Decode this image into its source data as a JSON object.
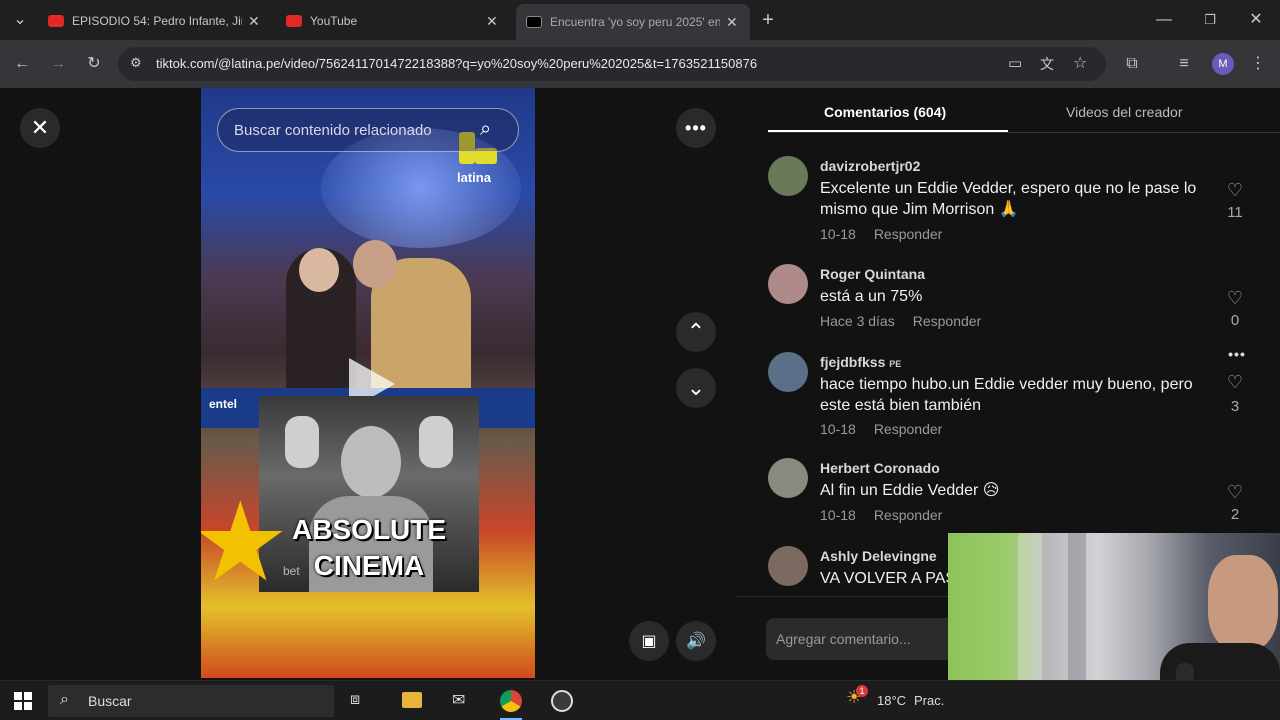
{
  "browser": {
    "tabs": [
      {
        "title": "EPISODIO 54: Pedro Infante, Jim",
        "favicon_color": "#e02a2a",
        "active": false
      },
      {
        "title": "YouTube",
        "favicon_color": "#e02a2a",
        "active": false
      },
      {
        "title": "Encuentra 'yo soy peru 2025' en",
        "favicon_color": "#000000",
        "active": true
      }
    ],
    "new_tab_icon": "plus-icon",
    "url": "tiktok.com/@latina.pe/video/7562411701472218388?q=yo%20soy%20peru%202025&t=1763521150876",
    "profile_initial": "M"
  },
  "video": {
    "search_placeholder": "Buscar contenido relacionado",
    "brand_logo_text": "latina",
    "sponsor_text": "entel",
    "overlay_text_line1": "ABSOLUTE",
    "overlay_text_line2": "CINEMA",
    "overlay_small": "bet"
  },
  "comments_panel": {
    "tab_comments": "Comentarios (604)",
    "tab_creator": "Videos del creador",
    "add_comment_placeholder": "Agregar comentario...",
    "items": [
      {
        "user": "davizrobertjr02",
        "badge": "",
        "text": "Excelente un Eddie Vedder, espero que no le pase lo mismo que Jim Morrison 🙏",
        "date": "10-18",
        "reply": "Responder",
        "likes": "11",
        "avatar_color": "#6a7a58"
      },
      {
        "user": "Roger Quintana",
        "badge": "",
        "text": "está a un 75%",
        "date": "Hace 3 días",
        "reply": "Responder",
        "likes": "0",
        "avatar_color": "#b08a8a"
      },
      {
        "user": "fjejdbfkss",
        "badge": "PE",
        "text": "hace tiempo hubo.un Eddie vedder muy bueno, pero este está bien también",
        "date": "10-18",
        "reply": "Responder",
        "likes": "3",
        "avatar_color": "#5a7088"
      },
      {
        "user": "Herbert Coronado",
        "badge": "",
        "text": "Al fin un Eddie Vedder 😥",
        "date": "10-18",
        "reply": "Responder",
        "likes": "2",
        "avatar_color": "#8a8a80"
      },
      {
        "user": "Ashly Delevingne",
        "badge": "",
        "text": "VA VOLVER A PAS",
        "date": "",
        "reply": "",
        "likes": "",
        "avatar_color": "#7a6a60"
      }
    ]
  },
  "taskbar": {
    "search_label": "Buscar",
    "temperature": "18°C",
    "weather_text": "Prac.",
    "notification_count": "1"
  }
}
